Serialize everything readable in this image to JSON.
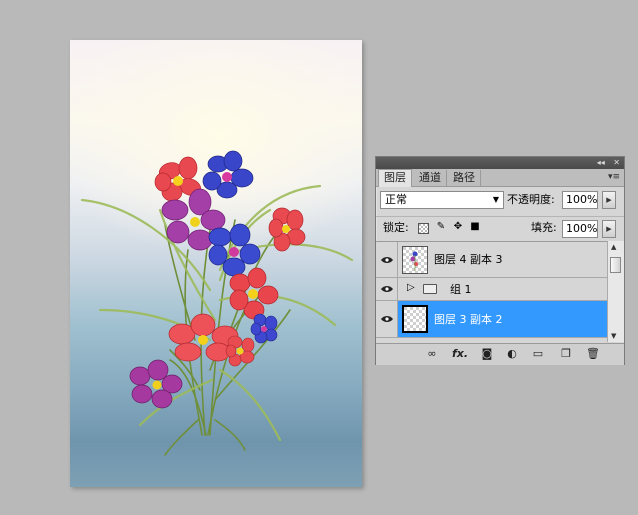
{
  "layers_panel": {
    "tabs": [
      "图层",
      "通道",
      "路径"
    ],
    "blend_mode": "正常",
    "opacity_label": "不透明度:",
    "opacity_value": "100%",
    "lock_label": "锁定:",
    "fill_label": "填充:",
    "fill_value": "100%",
    "layers": [
      {
        "name": "图层 4 副本 3",
        "type": "layer",
        "visible": true,
        "selected": false
      },
      {
        "name": "组 1",
        "type": "group",
        "visible": true,
        "selected": false
      },
      {
        "name": "图层 3 副本 2",
        "type": "layer",
        "visible": true,
        "selected": true
      }
    ],
    "bottom_icons": [
      "link-icon",
      "fx-icon",
      "mask-icon",
      "adjustment-icon",
      "folder-icon",
      "new-layer-icon",
      "trash-icon"
    ],
    "bottom_fx_text": "fx."
  },
  "colors": {
    "selected_layer": "#3399ff",
    "workspace": "#b9b9b9"
  }
}
